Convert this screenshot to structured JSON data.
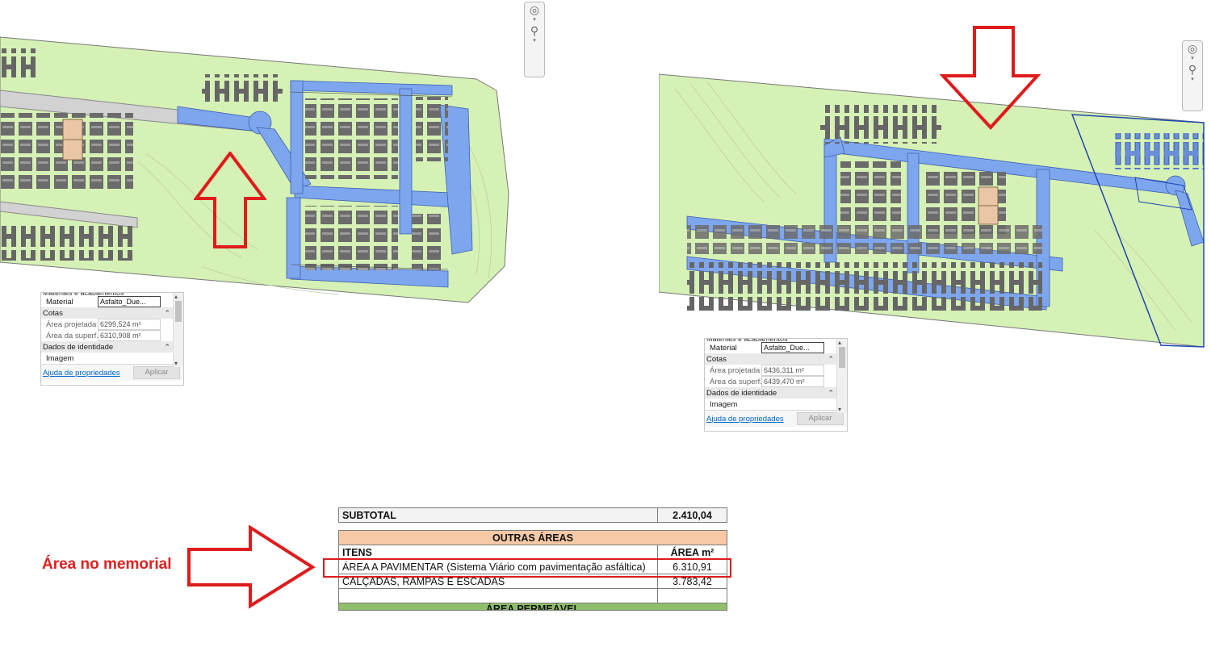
{
  "left_panel": {
    "header_cut": "Materiais e acabamentos",
    "material_label": "Material",
    "material_value": "Asfalto_Due...",
    "section_cotas": "Cotas",
    "area_projetada_label": "Área projetada",
    "area_projetada_value": "6299,524 m²",
    "area_superficie_label": "Área da superf...",
    "area_superficie_value": "6310,908 m²",
    "section_identidade": "Dados de identidade",
    "imagem_label": "Imagem",
    "help_link": "Ajuda de propriedades",
    "apply_button": "Aplicar"
  },
  "right_panel": {
    "header_cut": "Materiais e acabamentos",
    "material_label": "Material",
    "material_value": "Asfalto_Due...",
    "section_cotas": "Cotas",
    "area_projetada_label": "Área projetada",
    "area_projetada_value": "6436,311 m²",
    "area_superficie_label": "Área da superf...",
    "area_superficie_value": "6439,470 m²",
    "section_identidade": "Dados de identidade",
    "imagem_label": "Imagem",
    "help_link": "Ajuda de propriedades",
    "apply_button": "Aplicar"
  },
  "annotation": {
    "label": "Área no memorial"
  },
  "sheet": {
    "subtotal_label": "SUBTOTAL",
    "subtotal_value": "2.410,04",
    "section_title": "OUTRAS ÁREAS",
    "col_items": "ITENS",
    "col_area": "ÁREA m²",
    "row1_label": "ÁREA A PAVIMENTAR (Sistema Viário com pavimentação asfáltica)",
    "row1_value": "6.310,91",
    "row2_label": "CALÇADAS, RAMPAS E ESCADAS",
    "row2_value": "3.783,42",
    "next_section_cut": "ÁREA PERMEÁVEL"
  },
  "colors": {
    "grass": "#d6f1b5",
    "road": "#7ea6ee",
    "building": "#6b6b6b",
    "arrow": "#e01b1b",
    "section_orange": "#f7c9a6",
    "section_green": "#8fbf6a"
  }
}
